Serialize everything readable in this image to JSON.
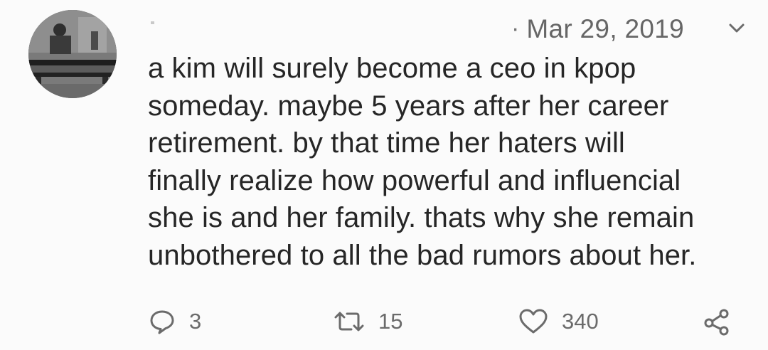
{
  "tweet": {
    "separator": "·",
    "date": "Mar 29, 2019",
    "lines": [
      "a kim will surely become a ceo in kpop",
      "someday. maybe 5 years after her career",
      "retirement. by that time her haters will",
      "finally realize how powerful and influencial",
      "she is and her family. thats why she remain",
      "unbothered to all the bad rumors about her."
    ]
  },
  "actions": {
    "reply": {
      "icon": "reply-icon",
      "count": "3"
    },
    "retweet": {
      "icon": "retweet-icon",
      "count": "15"
    },
    "like": {
      "icon": "heart-icon",
      "count": "340"
    },
    "share": {
      "icon": "share-icon"
    }
  },
  "icons": {
    "caret": "chevron-down-icon",
    "avatar": "avatar"
  },
  "colors": {
    "text": "#262626",
    "muted": "#6b6b6b",
    "background": "#fbfbfb"
  }
}
